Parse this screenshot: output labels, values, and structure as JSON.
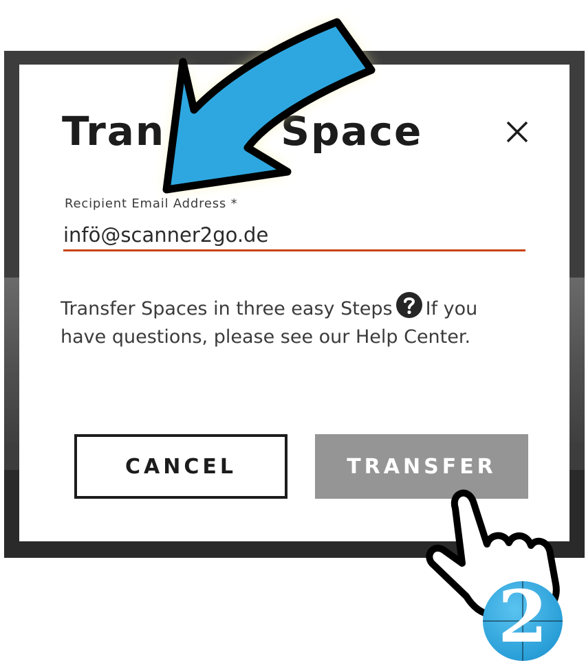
{
  "dialog": {
    "title_left": "Tran",
    "title_right": "Space",
    "field_label": "Recipient Email Address *",
    "email_value": "infö@scanner2go.de",
    "help_text_before": "Transfer Spaces in three easy Steps",
    "help_text_after": "If you have questions, please see our Help Center.",
    "cancel_label": "CANCEL",
    "transfer_label": "TRANSFER"
  },
  "overlays": {
    "logo_text": "2",
    "arrow_icon": "arrow-down-left",
    "pointer_icon": "pointing-hand"
  },
  "colors": {
    "accent_underline": "#c8430f",
    "transfer_button": "#959595",
    "arrow_fill": "#2ea7e0",
    "backdrop": "#3d3d3d"
  }
}
